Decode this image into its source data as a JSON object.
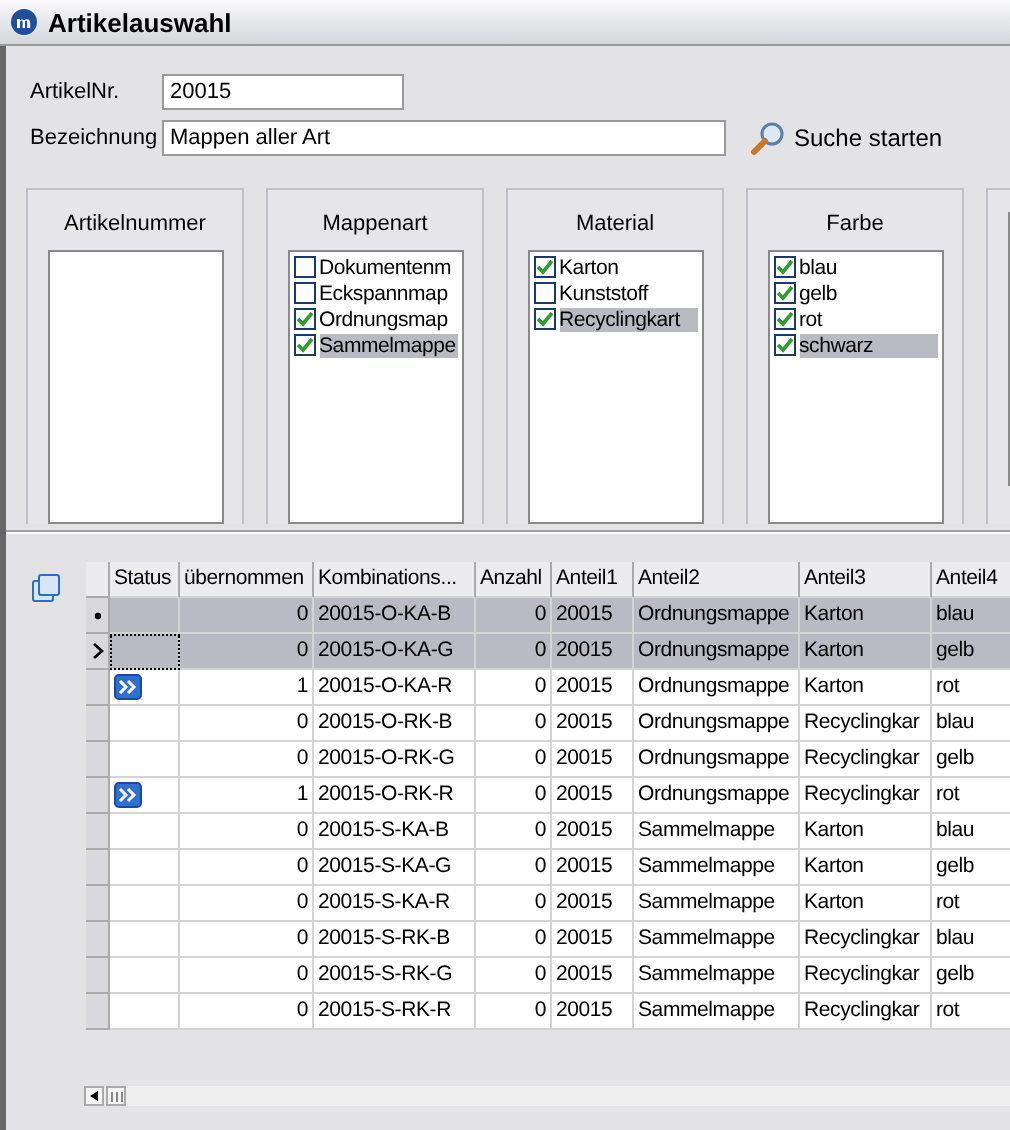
{
  "window": {
    "title": "Artikelauswahl"
  },
  "search": {
    "article_label": "ArtikelNr.",
    "article_value": "20015",
    "name_label": "Bezeichnung",
    "name_value": "Mappen aller Art",
    "button": "Suche starten"
  },
  "filters": [
    {
      "title": "Artikelnummer"
    },
    {
      "title": "Mappenart",
      "items": [
        {
          "label": "Dokumentenm",
          "checked": false,
          "selected": false
        },
        {
          "label": "Eckspannmap",
          "checked": false,
          "selected": false
        },
        {
          "label": "Ordnungsmap",
          "checked": true,
          "selected": false
        },
        {
          "label": "Sammelmappe",
          "checked": true,
          "selected": true
        }
      ]
    },
    {
      "title": "Material",
      "items": [
        {
          "label": "Karton",
          "checked": true,
          "selected": false
        },
        {
          "label": "Kunststoff",
          "checked": false,
          "selected": false
        },
        {
          "label": "Recyclingkart",
          "checked": true,
          "selected": true
        }
      ]
    },
    {
      "title": "Farbe",
      "items": [
        {
          "label": "blau",
          "checked": true,
          "selected": false
        },
        {
          "label": "gelb",
          "checked": true,
          "selected": false
        },
        {
          "label": "rot",
          "checked": true,
          "selected": false
        },
        {
          "label": "schwarz",
          "checked": true,
          "selected": true
        }
      ]
    }
  ],
  "table": {
    "columns": [
      "Status",
      "übernommen",
      "Kombinations...",
      "Anzahl",
      "Anteil1",
      "Anteil2",
      "Anteil3",
      "Anteil4"
    ],
    "rows": [
      {
        "marked": true,
        "current": false,
        "selected": true,
        "transferred": false,
        "cells": [
          "",
          "0",
          "20015-O-KA-B",
          "0",
          "20015",
          "Ordnungsmappe",
          "Karton",
          "blau"
        ]
      },
      {
        "marked": false,
        "current": true,
        "selected": true,
        "transferred": false,
        "cells": [
          "",
          "0",
          "20015-O-KA-G",
          "0",
          "20015",
          "Ordnungsmappe",
          "Karton",
          "gelb"
        ]
      },
      {
        "marked": false,
        "current": false,
        "selected": false,
        "transferred": true,
        "cells": [
          "",
          "1",
          "20015-O-KA-R",
          "0",
          "20015",
          "Ordnungsmappe",
          "Karton",
          "rot"
        ]
      },
      {
        "marked": false,
        "current": false,
        "selected": false,
        "transferred": false,
        "cells": [
          "",
          "0",
          "20015-O-RK-B",
          "0",
          "20015",
          "Ordnungsmappe",
          "Recyclingkar",
          "blau"
        ]
      },
      {
        "marked": false,
        "current": false,
        "selected": false,
        "transferred": false,
        "cells": [
          "",
          "0",
          "20015-O-RK-G",
          "0",
          "20015",
          "Ordnungsmappe",
          "Recyclingkar",
          "gelb"
        ]
      },
      {
        "marked": false,
        "current": false,
        "selected": false,
        "transferred": true,
        "cells": [
          "",
          "1",
          "20015-O-RK-R",
          "0",
          "20015",
          "Ordnungsmappe",
          "Recyclingkar",
          "rot"
        ]
      },
      {
        "marked": false,
        "current": false,
        "selected": false,
        "transferred": false,
        "cells": [
          "",
          "0",
          "20015-S-KA-B",
          "0",
          "20015",
          "Sammelmappe",
          "Karton",
          "blau"
        ]
      },
      {
        "marked": false,
        "current": false,
        "selected": false,
        "transferred": false,
        "cells": [
          "",
          "0",
          "20015-S-KA-G",
          "0",
          "20015",
          "Sammelmappe",
          "Karton",
          "gelb"
        ]
      },
      {
        "marked": false,
        "current": false,
        "selected": false,
        "transferred": false,
        "cells": [
          "",
          "0",
          "20015-S-KA-R",
          "0",
          "20015",
          "Sammelmappe",
          "Karton",
          "rot"
        ]
      },
      {
        "marked": false,
        "current": false,
        "selected": false,
        "transferred": false,
        "cells": [
          "",
          "0",
          "20015-S-RK-B",
          "0",
          "20015",
          "Sammelmappe",
          "Recyclingkar",
          "blau"
        ]
      },
      {
        "marked": false,
        "current": false,
        "selected": false,
        "transferred": false,
        "cells": [
          "",
          "0",
          "20015-S-RK-G",
          "0",
          "20015",
          "Sammelmappe",
          "Recyclingkar",
          "gelb"
        ]
      },
      {
        "marked": false,
        "current": false,
        "selected": false,
        "transferred": false,
        "cells": [
          "",
          "0",
          "20015-S-RK-R",
          "0",
          "20015",
          "Sammelmappe",
          "Recyclingkar",
          "rot"
        ]
      }
    ]
  }
}
